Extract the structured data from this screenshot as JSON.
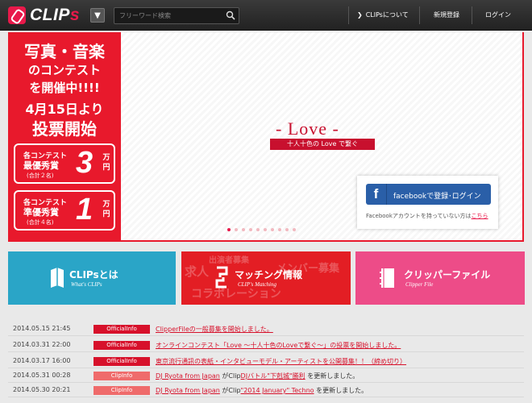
{
  "header": {
    "logo_text": "CLIPs",
    "search_placeholder": "フリーワード検索",
    "nav": [
      "CLIPsについて",
      "新規登録",
      "ログイン"
    ]
  },
  "hero": {
    "promo_lines": [
      "写真・音楽",
      "のコンテスト",
      "を開催中!!!!",
      "4月15日より",
      "投票開始"
    ],
    "prize_top": {
      "label1": "各コンテスト",
      "label2": "最優秀賞",
      "note": "(合計２名)",
      "amount": "3",
      "unit": "万円"
    },
    "prize_bottom": {
      "label1": "各コンテスト",
      "label2": "準優秀賞",
      "note": "(合計４名)",
      "amount": "1",
      "unit": "万円"
    },
    "title": "- Love -",
    "subtitle": "十人十色の Love で繋ぐ",
    "facebook_button": "facebookで登録･ログイン",
    "facebook_note": "Facebookアカウントを持っていない方は",
    "facebook_note_link": "こちら"
  },
  "tiles": [
    {
      "title": "CLIPsとは",
      "sub": "What's CLIPs"
    },
    {
      "title": "マッチング情報",
      "sub": "CLIP's Matching",
      "bg_words": [
        "出演者募集",
        "求人",
        "メンバー募集",
        "コラボレーション"
      ]
    },
    {
      "title": "クリッパーファイル",
      "sub": "Clipper File"
    }
  ],
  "news": [
    {
      "date": "2014.05.15 21:45",
      "badge": "OfficialInfo",
      "badge_type": "official",
      "link": "ClipperFileの一般募集を開始しました。",
      "suffix": ""
    },
    {
      "date": "2014.03.31 22:00",
      "badge": "OfficialInfo",
      "badge_type": "official",
      "link": "オンラインコンテスト「Love 〜十人十色のLoveで繋ぐ〜」の投票を開始しました。",
      "suffix": ""
    },
    {
      "date": "2014.03.17 16:00",
      "badge": "OfficialInfo",
      "badge_type": "official",
      "link": "東京流行通訊の表紙・インタビューモデル・アーティストを公開募集！！（締め切り）",
      "suffix": ""
    },
    {
      "date": "2014.05.31 00:28",
      "badge": "ClipInfo",
      "badge_type": "clip",
      "link": "DJ Ryota from Japan",
      "mid": "がClip",
      "link2": "DJバトル\"下剋城\"勝利",
      "suffix": "を更新しました。"
    },
    {
      "date": "2014.05.30 20:21",
      "badge": "ClipInfo",
      "badge_type": "clip",
      "link": "DJ Ryota from Japan",
      "mid": "がClip",
      "link2": "\"2014 January\" Techno",
      "suffix": "を更新しました。"
    }
  ],
  "colors": {
    "brand_red": "#e8192c",
    "cyan": "#2aa5c7",
    "pink": "#ed4c88",
    "facebook": "#2a5fa8"
  }
}
